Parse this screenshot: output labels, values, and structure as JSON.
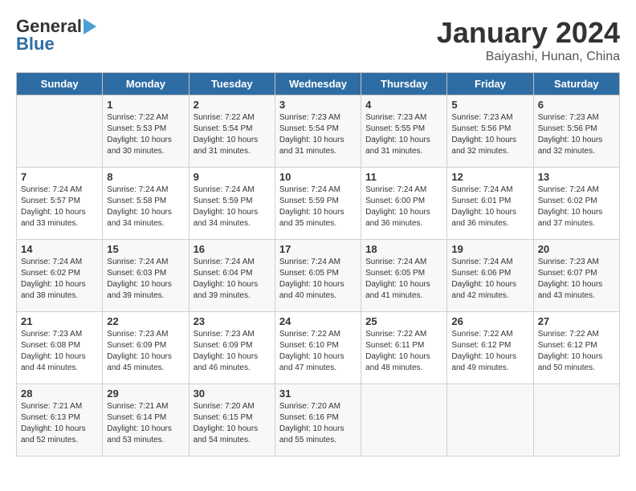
{
  "header": {
    "logo_line1": "General",
    "logo_line2": "Blue",
    "title": "January 2024",
    "subtitle": "Baiyashi, Hunan, China"
  },
  "days_of_week": [
    "Sunday",
    "Monday",
    "Tuesday",
    "Wednesday",
    "Thursday",
    "Friday",
    "Saturday"
  ],
  "weeks": [
    [
      {
        "num": "",
        "info": ""
      },
      {
        "num": "1",
        "info": "Sunrise: 7:22 AM\nSunset: 5:53 PM\nDaylight: 10 hours\nand 30 minutes."
      },
      {
        "num": "2",
        "info": "Sunrise: 7:22 AM\nSunset: 5:54 PM\nDaylight: 10 hours\nand 31 minutes."
      },
      {
        "num": "3",
        "info": "Sunrise: 7:23 AM\nSunset: 5:54 PM\nDaylight: 10 hours\nand 31 minutes."
      },
      {
        "num": "4",
        "info": "Sunrise: 7:23 AM\nSunset: 5:55 PM\nDaylight: 10 hours\nand 31 minutes."
      },
      {
        "num": "5",
        "info": "Sunrise: 7:23 AM\nSunset: 5:56 PM\nDaylight: 10 hours\nand 32 minutes."
      },
      {
        "num": "6",
        "info": "Sunrise: 7:23 AM\nSunset: 5:56 PM\nDaylight: 10 hours\nand 32 minutes."
      }
    ],
    [
      {
        "num": "7",
        "info": "Sunrise: 7:24 AM\nSunset: 5:57 PM\nDaylight: 10 hours\nand 33 minutes."
      },
      {
        "num": "8",
        "info": "Sunrise: 7:24 AM\nSunset: 5:58 PM\nDaylight: 10 hours\nand 34 minutes."
      },
      {
        "num": "9",
        "info": "Sunrise: 7:24 AM\nSunset: 5:59 PM\nDaylight: 10 hours\nand 34 minutes."
      },
      {
        "num": "10",
        "info": "Sunrise: 7:24 AM\nSunset: 5:59 PM\nDaylight: 10 hours\nand 35 minutes."
      },
      {
        "num": "11",
        "info": "Sunrise: 7:24 AM\nSunset: 6:00 PM\nDaylight: 10 hours\nand 36 minutes."
      },
      {
        "num": "12",
        "info": "Sunrise: 7:24 AM\nSunset: 6:01 PM\nDaylight: 10 hours\nand 36 minutes."
      },
      {
        "num": "13",
        "info": "Sunrise: 7:24 AM\nSunset: 6:02 PM\nDaylight: 10 hours\nand 37 minutes."
      }
    ],
    [
      {
        "num": "14",
        "info": "Sunrise: 7:24 AM\nSunset: 6:02 PM\nDaylight: 10 hours\nand 38 minutes."
      },
      {
        "num": "15",
        "info": "Sunrise: 7:24 AM\nSunset: 6:03 PM\nDaylight: 10 hours\nand 39 minutes."
      },
      {
        "num": "16",
        "info": "Sunrise: 7:24 AM\nSunset: 6:04 PM\nDaylight: 10 hours\nand 39 minutes."
      },
      {
        "num": "17",
        "info": "Sunrise: 7:24 AM\nSunset: 6:05 PM\nDaylight: 10 hours\nand 40 minutes."
      },
      {
        "num": "18",
        "info": "Sunrise: 7:24 AM\nSunset: 6:05 PM\nDaylight: 10 hours\nand 41 minutes."
      },
      {
        "num": "19",
        "info": "Sunrise: 7:24 AM\nSunset: 6:06 PM\nDaylight: 10 hours\nand 42 minutes."
      },
      {
        "num": "20",
        "info": "Sunrise: 7:23 AM\nSunset: 6:07 PM\nDaylight: 10 hours\nand 43 minutes."
      }
    ],
    [
      {
        "num": "21",
        "info": "Sunrise: 7:23 AM\nSunset: 6:08 PM\nDaylight: 10 hours\nand 44 minutes."
      },
      {
        "num": "22",
        "info": "Sunrise: 7:23 AM\nSunset: 6:09 PM\nDaylight: 10 hours\nand 45 minutes."
      },
      {
        "num": "23",
        "info": "Sunrise: 7:23 AM\nSunset: 6:09 PM\nDaylight: 10 hours\nand 46 minutes."
      },
      {
        "num": "24",
        "info": "Sunrise: 7:22 AM\nSunset: 6:10 PM\nDaylight: 10 hours\nand 47 minutes."
      },
      {
        "num": "25",
        "info": "Sunrise: 7:22 AM\nSunset: 6:11 PM\nDaylight: 10 hours\nand 48 minutes."
      },
      {
        "num": "26",
        "info": "Sunrise: 7:22 AM\nSunset: 6:12 PM\nDaylight: 10 hours\nand 49 minutes."
      },
      {
        "num": "27",
        "info": "Sunrise: 7:22 AM\nSunset: 6:12 PM\nDaylight: 10 hours\nand 50 minutes."
      }
    ],
    [
      {
        "num": "28",
        "info": "Sunrise: 7:21 AM\nSunset: 6:13 PM\nDaylight: 10 hours\nand 52 minutes."
      },
      {
        "num": "29",
        "info": "Sunrise: 7:21 AM\nSunset: 6:14 PM\nDaylight: 10 hours\nand 53 minutes."
      },
      {
        "num": "30",
        "info": "Sunrise: 7:20 AM\nSunset: 6:15 PM\nDaylight: 10 hours\nand 54 minutes."
      },
      {
        "num": "31",
        "info": "Sunrise: 7:20 AM\nSunset: 6:16 PM\nDaylight: 10 hours\nand 55 minutes."
      },
      {
        "num": "",
        "info": ""
      },
      {
        "num": "",
        "info": ""
      },
      {
        "num": "",
        "info": ""
      }
    ]
  ]
}
